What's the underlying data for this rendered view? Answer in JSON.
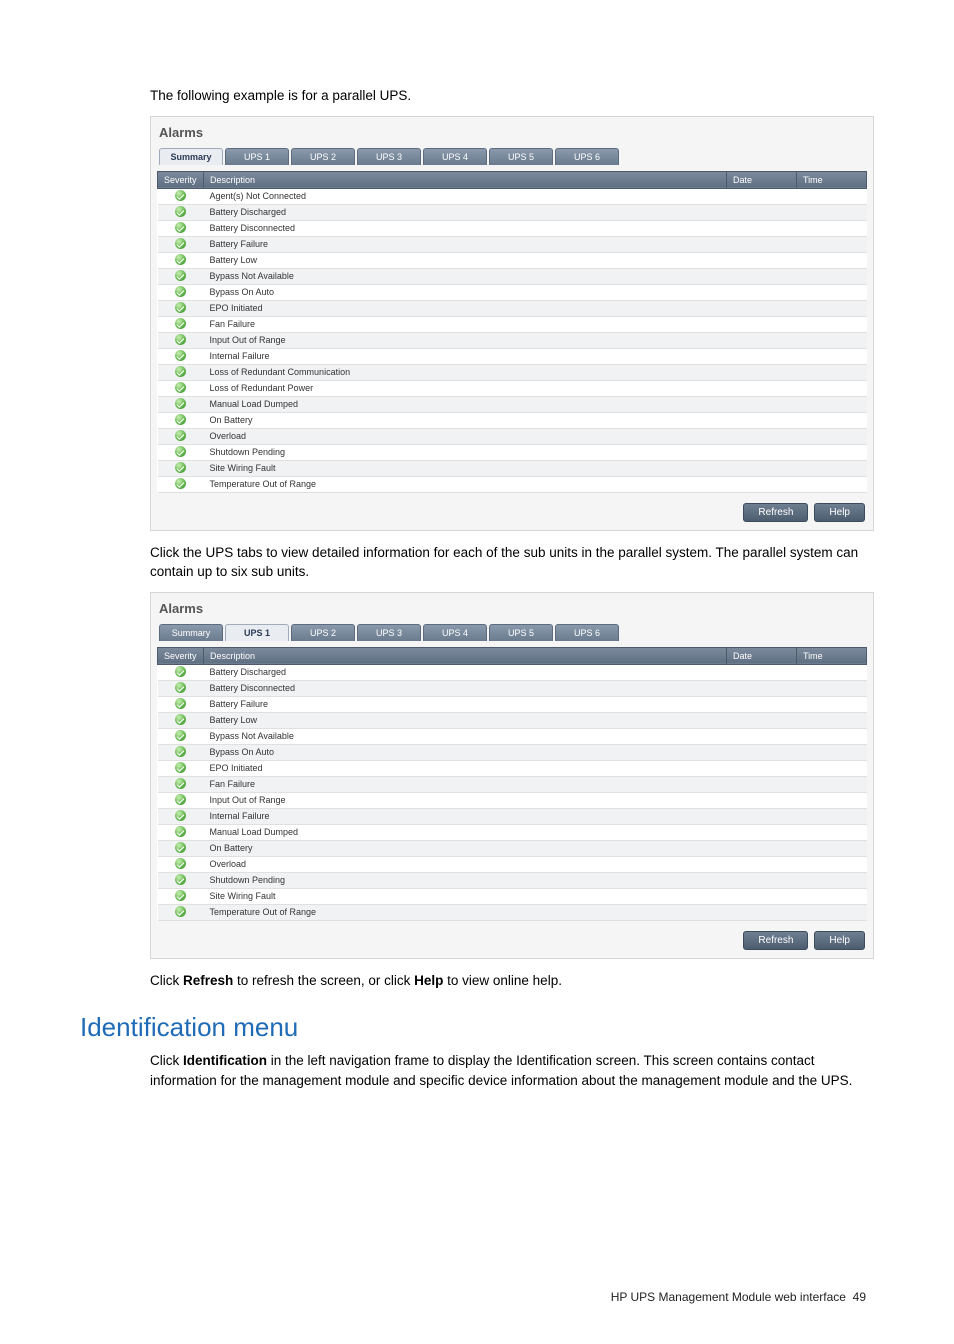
{
  "intro_text": "The following example is for a parallel UPS.",
  "panel1": {
    "title": "Alarms",
    "tabs": [
      "Summary",
      "UPS 1",
      "UPS 2",
      "UPS 3",
      "UPS 4",
      "UPS 5",
      "UPS 6"
    ],
    "active_tab": 0,
    "columns": {
      "severity": "Severity",
      "description": "Description",
      "date": "Date",
      "time": "Time"
    },
    "rows": [
      "Agent(s) Not Connected",
      "Battery Discharged",
      "Battery Disconnected",
      "Battery Failure",
      "Battery Low",
      "Bypass Not Available",
      "Bypass On Auto",
      "EPO Initiated",
      "Fan Failure",
      "Input Out of Range",
      "Internal Failure",
      "Loss of Redundant Communication",
      "Loss of Redundant Power",
      "Manual Load Dumped",
      "On Battery",
      "Overload",
      "Shutdown Pending",
      "Site Wiring Fault",
      "Temperature Out of Range"
    ],
    "buttons": {
      "refresh": "Refresh",
      "help": "Help"
    }
  },
  "mid_text": "Click the UPS tabs to view detailed information for each of the sub units in the parallel system. The parallel system can contain up to six sub units.",
  "panel2": {
    "title": "Alarms",
    "tabs": [
      "Summary",
      "UPS 1",
      "UPS 2",
      "UPS 3",
      "UPS 4",
      "UPS 5",
      "UPS 6"
    ],
    "active_tab": 1,
    "columns": {
      "severity": "Severity",
      "description": "Description",
      "date": "Date",
      "time": "Time"
    },
    "rows": [
      "Battery Discharged",
      "Battery Disconnected",
      "Battery Failure",
      "Battery Low",
      "Bypass Not Available",
      "Bypass On Auto",
      "EPO Initiated",
      "Fan Failure",
      "Input Out of Range",
      "Internal Failure",
      "Manual Load Dumped",
      "On Battery",
      "Overload",
      "Shutdown Pending",
      "Site Wiring Fault",
      "Temperature Out of Range"
    ],
    "buttons": {
      "refresh": "Refresh",
      "help": "Help"
    }
  },
  "after_panel2": {
    "pre": "Click ",
    "b1": "Refresh",
    "mid1": " to refresh the screen, or click ",
    "b2": "Help",
    "post": " to view online help."
  },
  "section_heading": "Identification menu",
  "section_body": {
    "pre": "Click ",
    "b1": "Identification",
    "post": " in the left navigation frame to display the Identification screen. This screen contains contact information for the management module and specific device information about the management module and the UPS."
  },
  "footer": {
    "text": "HP UPS Management Module web interface",
    "page": "49"
  }
}
